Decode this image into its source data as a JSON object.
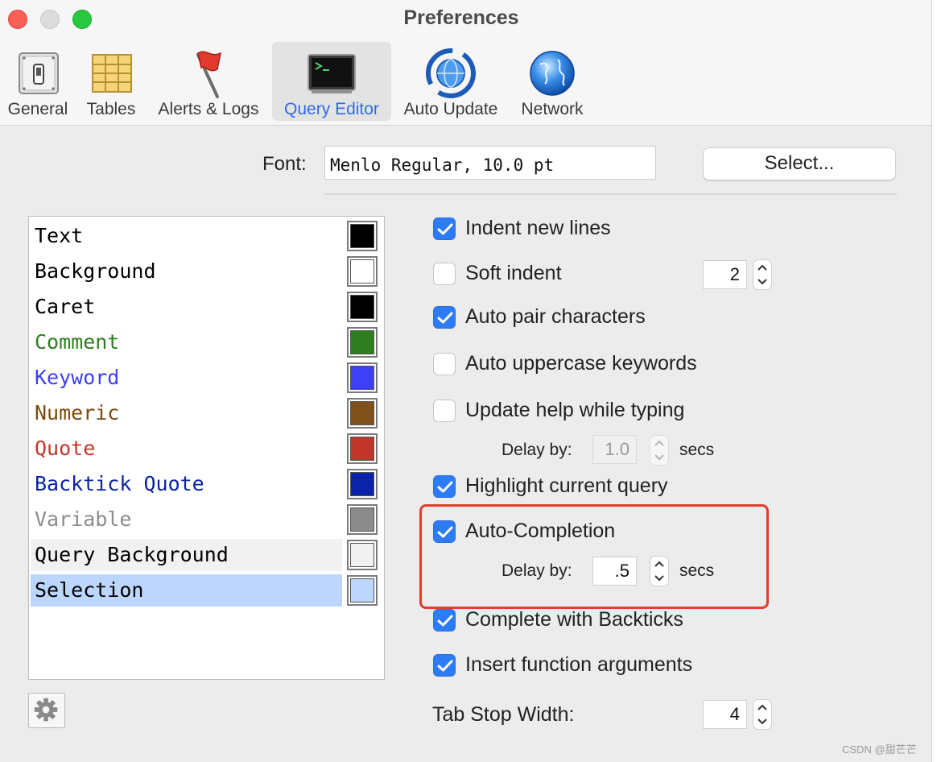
{
  "window": {
    "title": "Preferences"
  },
  "toolbar": {
    "items": [
      {
        "label": "General",
        "icon": "switch-icon"
      },
      {
        "label": "Tables",
        "icon": "table-grid-icon"
      },
      {
        "label": "Alerts & Logs",
        "icon": "flag-icon"
      },
      {
        "label": "Query Editor",
        "icon": "terminal-icon",
        "selected": true
      },
      {
        "label": "Auto Update",
        "icon": "update-globe-icon"
      },
      {
        "label": "Network",
        "icon": "globe-icon"
      }
    ]
  },
  "font": {
    "label": "Font:",
    "value": "Menlo Regular, 10.0 pt",
    "select_label": "Select..."
  },
  "syntax_colors": [
    {
      "label": "Text",
      "text_color": "#000000",
      "swatch": "#000000"
    },
    {
      "label": "Background",
      "text_color": "#000000",
      "swatch": "#ffffff"
    },
    {
      "label": "Caret",
      "text_color": "#000000",
      "swatch": "#000000"
    },
    {
      "label": "Comment",
      "text_color": "#2e7d1f",
      "swatch": "#2e7d1f"
    },
    {
      "label": "Keyword",
      "text_color": "#3f3ff5",
      "swatch": "#3f3ff5"
    },
    {
      "label": "Numeric",
      "text_color": "#7a4a10",
      "swatch": "#80501a"
    },
    {
      "label": "Quote",
      "text_color": "#c2362a",
      "swatch": "#c2362a"
    },
    {
      "label": "Backtick Quote",
      "text_color": "#0a23a8",
      "swatch": "#0a23a8"
    },
    {
      "label": "Variable",
      "text_color": "#8c8c8c",
      "swatch": "#8c8c8c"
    },
    {
      "label": "Query Background",
      "text_color": "#000000",
      "swatch": "#f1f1f1"
    },
    {
      "label": "Selection",
      "text_color": "#000000",
      "swatch": "#bcd7fb",
      "selected": true
    }
  ],
  "options": {
    "indent_new_lines": {
      "label": "Indent new lines",
      "checked": true
    },
    "soft_indent": {
      "label": "Soft indent",
      "checked": false,
      "value": "2"
    },
    "auto_pair": {
      "label": "Auto pair characters",
      "checked": true
    },
    "auto_uppercase": {
      "label": "Auto uppercase keywords",
      "checked": false
    },
    "update_help": {
      "label": "Update help while typing",
      "checked": false,
      "delay_label": "Delay by:",
      "delay_value": "1.0",
      "unit": "secs"
    },
    "highlight_query": {
      "label": "Highlight current query",
      "checked": true
    },
    "auto_completion": {
      "label": "Auto-Completion",
      "checked": true,
      "delay_label": "Delay by:",
      "delay_value": ".5",
      "unit": "secs"
    },
    "complete_backticks": {
      "label": "Complete with Backticks",
      "checked": true
    },
    "insert_args": {
      "label": "Insert function arguments",
      "checked": true
    },
    "tab_stop": {
      "label": "Tab Stop Width:",
      "value": "4"
    }
  },
  "colors": {
    "accent": "#2d7cf6",
    "highlight_box": "#e53c2c"
  },
  "watermark": "CSDN @甜芒芒"
}
